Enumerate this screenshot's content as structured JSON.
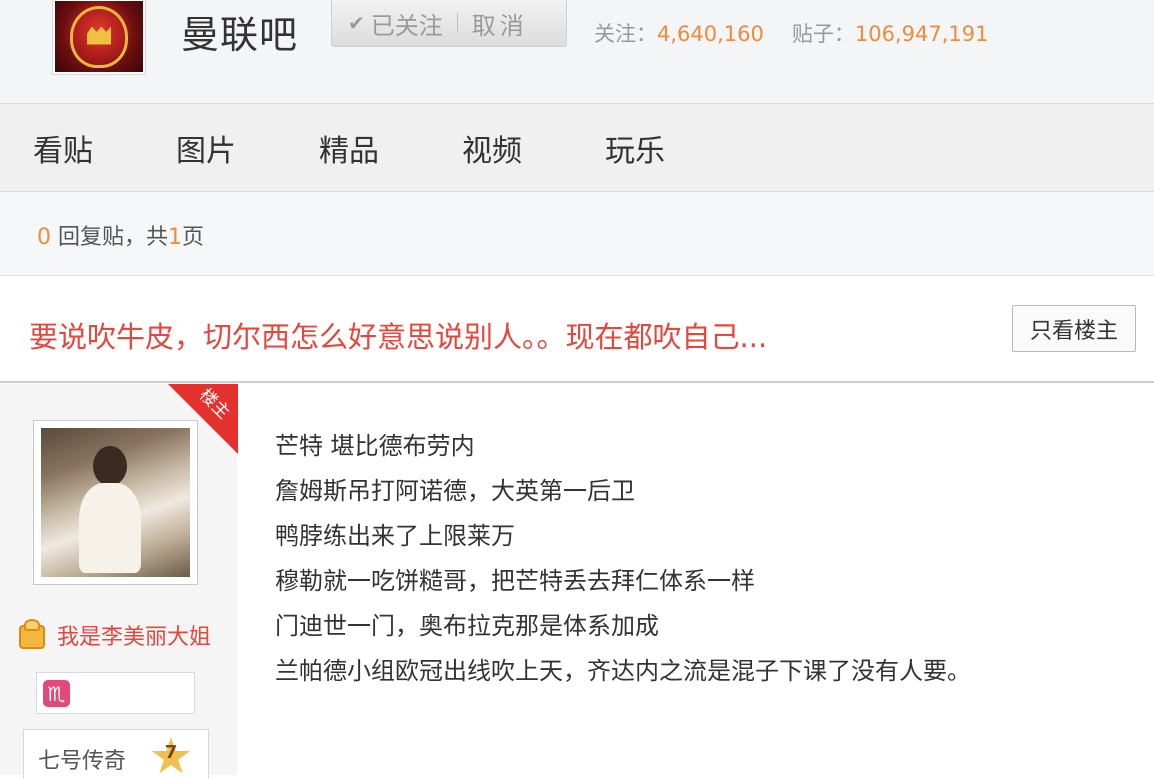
{
  "header": {
    "forum_name": "曼联吧",
    "follow": {
      "check": "✔",
      "followed_label": "已关注",
      "cancel_label": "取消"
    },
    "stats": {
      "follow_label": "关注：",
      "follow_count": "4,640,160",
      "posts_label": "贴子：",
      "posts_count": "106,947,191"
    }
  },
  "nav": {
    "items": [
      "看贴",
      "图片",
      "精品",
      "视频",
      "玩乐"
    ]
  },
  "reply_bar": {
    "reply_count": "0",
    "reply_text": " 回复贴，共",
    "pages": "1",
    "page_suffix": "页"
  },
  "thread": {
    "title": "要说吹牛皮，切尔西怎么好意思说别人。。现在都吹自己...",
    "only_op_label": "只看楼主"
  },
  "post": {
    "op_ribbon": "楼主",
    "username": "我是李美丽大姐",
    "zodiac_glyph": "♏",
    "level_name": "七号传奇",
    "level": "7",
    "lines": [
      "芒特 堪比德布劳内",
      "詹姆斯吊打阿诺德，大英第一后卫",
      "鸭脖练出来了上限莱万",
      "穆勒就一吃饼糙哥，把芒特丢去拜仁体系一样",
      "门迪世一门，奥布拉克那是体系加成",
      "兰帕德小组欧冠出线吹上天，齐达内之流是混子下课了没有人要。"
    ]
  },
  "colors": {
    "accent_red": "#e5473d",
    "number_orange": "#f08a3c"
  }
}
